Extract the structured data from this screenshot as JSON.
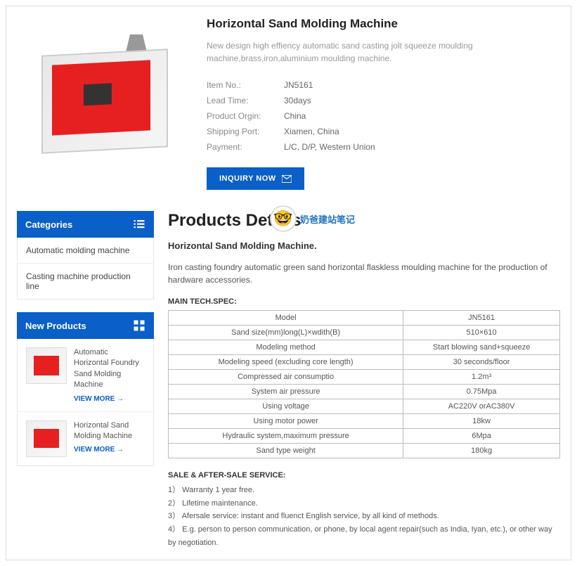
{
  "product": {
    "title": "Horizontal Sand Molding Machine",
    "description": "New design high effiency automatic sand casting jolt squeeze moulding machine,brass,iron,aluminium moulding machine.",
    "info": [
      {
        "label": "Item No.:",
        "value": "JN5161"
      },
      {
        "label": "Lead Time:",
        "value": "30days"
      },
      {
        "label": "Product Orgin:",
        "value": "China"
      },
      {
        "label": "Shipping Port:",
        "value": "Xiamen, China"
      },
      {
        "label": "Payment:",
        "value": "L/C, D/P, Western Union"
      }
    ],
    "inquiry_label": "INQUIRY NOW"
  },
  "sidebar": {
    "categories_title": "Categories",
    "categories": [
      "Automatic molding machine",
      "Casting machine production line"
    ],
    "new_products_title": "New Products",
    "new_products": [
      {
        "title": "Automatic Horizontal Foundry Sand Molding Machine",
        "more": "VIEW MORE →"
      },
      {
        "title": "Horizontal Sand Molding Machine",
        "more": "VIEW MORE →"
      }
    ]
  },
  "details": {
    "heading": "Products Details",
    "avatar_text": "奶爸建站笔记",
    "subtitle": "Horizontal Sand Molding Machine.",
    "description": "Iron casting foundry automatic green sand horizontal flaskless moulding machine for the production of hardware accessories.",
    "spec_label": "MAIN TECH.SPEC:",
    "specs": [
      {
        "k": "Model",
        "v": "JN5161"
      },
      {
        "k": "Sand size(mm)long(L)×wdith(B)",
        "v": "510×610"
      },
      {
        "k": "Modeling method",
        "v": "Start blowing sand+squeeze"
      },
      {
        "k": "Modeling speed (excluding core length)",
        "v": "30 seconds/floor"
      },
      {
        "k": "Compressed air consumptio",
        "v": "1.2m³"
      },
      {
        "k": "System air pressure",
        "v": "0.75Mpa"
      },
      {
        "k": "Using voltage",
        "v": "AC220V orAC380V"
      },
      {
        "k": "Using motor power",
        "v": "18kw"
      },
      {
        "k": "Hydraulic system,maximum pressure",
        "v": "6Mpa"
      },
      {
        "k": "Sand type weight",
        "v": "180kg"
      }
    ],
    "service_title": "SALE & AFTER-SALE SERVICE:",
    "service": [
      "1） Warranty 1 year free.",
      "2） Lifetime maintenance.",
      "3） Afersale service: instant and fluenct English service, by all kind of methods.",
      "4） E.g. person to person communication, or phone,    by local agent repair(such as India, Iyan, etc.), or other way by negotiation."
    ]
  }
}
